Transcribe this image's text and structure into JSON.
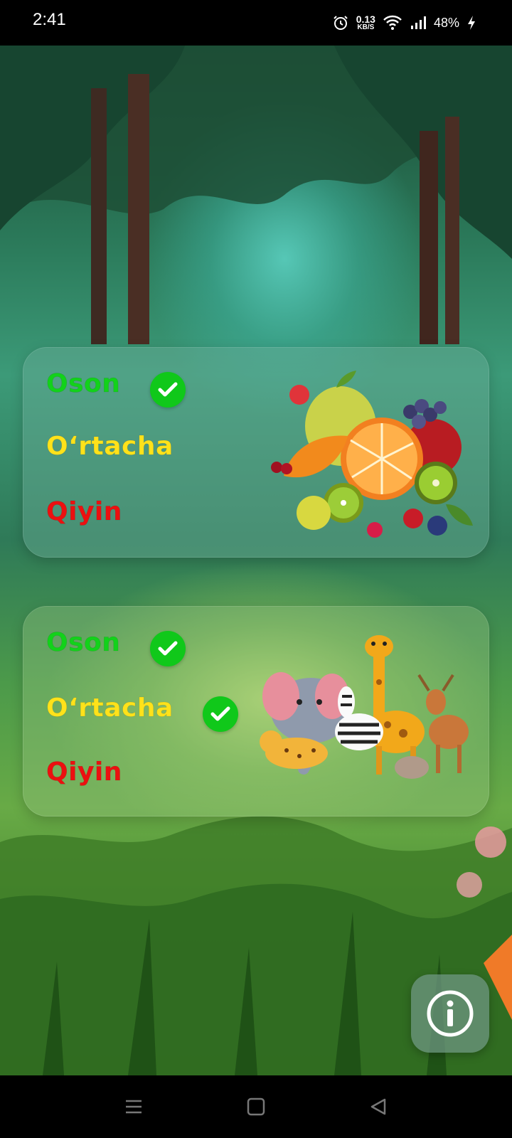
{
  "status_bar": {
    "time": "2:41",
    "net_speed_value": "0.13",
    "net_speed_unit": "KB/S",
    "battery": "48%",
    "icons": [
      "alarm-icon",
      "wifi-icon",
      "signal-icon",
      "battery-charging-icon"
    ]
  },
  "categories": [
    {
      "name": "fruits",
      "illustration": "fruits-illustration",
      "levels": [
        {
          "label": "Oson",
          "completed": true
        },
        {
          "label": "O‘rtacha",
          "completed": false
        },
        {
          "label": "Qiyin",
          "completed": false
        }
      ]
    },
    {
      "name": "animals",
      "illustration": "animals-illustration",
      "levels": [
        {
          "label": "Oson",
          "completed": true
        },
        {
          "label": "O‘rtacha",
          "completed": true
        },
        {
          "label": "Qiyin",
          "completed": false
        }
      ]
    }
  ],
  "info_button": {
    "icon": "info-icon"
  },
  "nav_bar": {
    "icons": [
      "menu-icon",
      "home-icon",
      "back-icon"
    ]
  },
  "colors": {
    "easy": "#12d21a",
    "medium": "#ffe21a",
    "hard": "#ec1010",
    "check": "#10c81a"
  }
}
